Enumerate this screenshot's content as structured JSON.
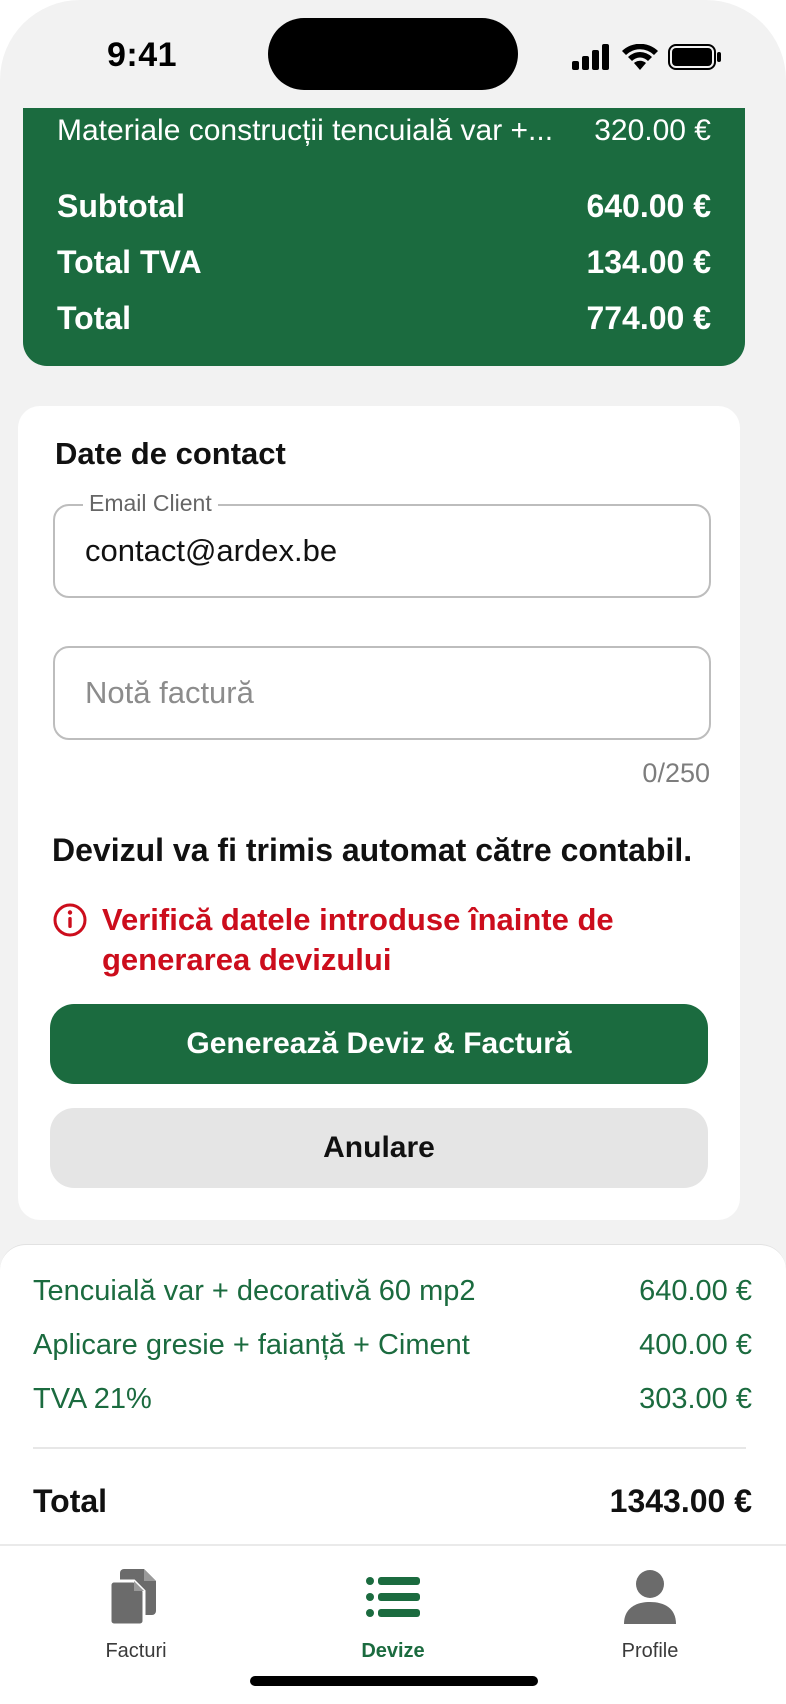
{
  "status_bar": {
    "time": "9:41"
  },
  "summary": {
    "item": {
      "label": "Materiale construcții tencuială var +...",
      "amount": "320.00 €"
    },
    "subtotal": {
      "label": "Subtotal",
      "amount": "640.00 €"
    },
    "tva": {
      "label": "Total TVA",
      "amount": "134.00 €"
    },
    "total": {
      "label": "Total",
      "amount": "774.00 €"
    },
    "color": "#1b6b3f"
  },
  "contact": {
    "title": "Date de contact",
    "email": {
      "legend": "Email Client",
      "value": "contact@ardex.be"
    },
    "note": {
      "placeholder": "Notă factură",
      "value": ""
    },
    "counter": "0/250",
    "notice": "Devizul va fi trimis automat către contabil.",
    "warning": "Verifică datele introduse înainte de generarea devizului",
    "warning_icon": "info-circle-icon",
    "warning_color": "#cc0d1c",
    "generate_button": "Generează Deviz & Factură",
    "cancel_button": "Anulare"
  },
  "sheet": {
    "items": [
      {
        "label": "Tencuială var + decorativă 60 mp2",
        "amount": "640.00 €"
      },
      {
        "label": "Aplicare gresie + faianță + Ciment",
        "amount": "400.00 €"
      },
      {
        "label": "TVA 21%",
        "amount": "303.00 €"
      }
    ],
    "total": {
      "label": "Total",
      "amount": "1343.00 €"
    }
  },
  "tabbar": {
    "tabs": [
      {
        "label": "Facturi",
        "icon": "documents-icon",
        "active": false
      },
      {
        "label": "Devize",
        "icon": "list-icon",
        "active": true
      },
      {
        "label": "Profile",
        "icon": "person-icon",
        "active": false
      }
    ]
  }
}
